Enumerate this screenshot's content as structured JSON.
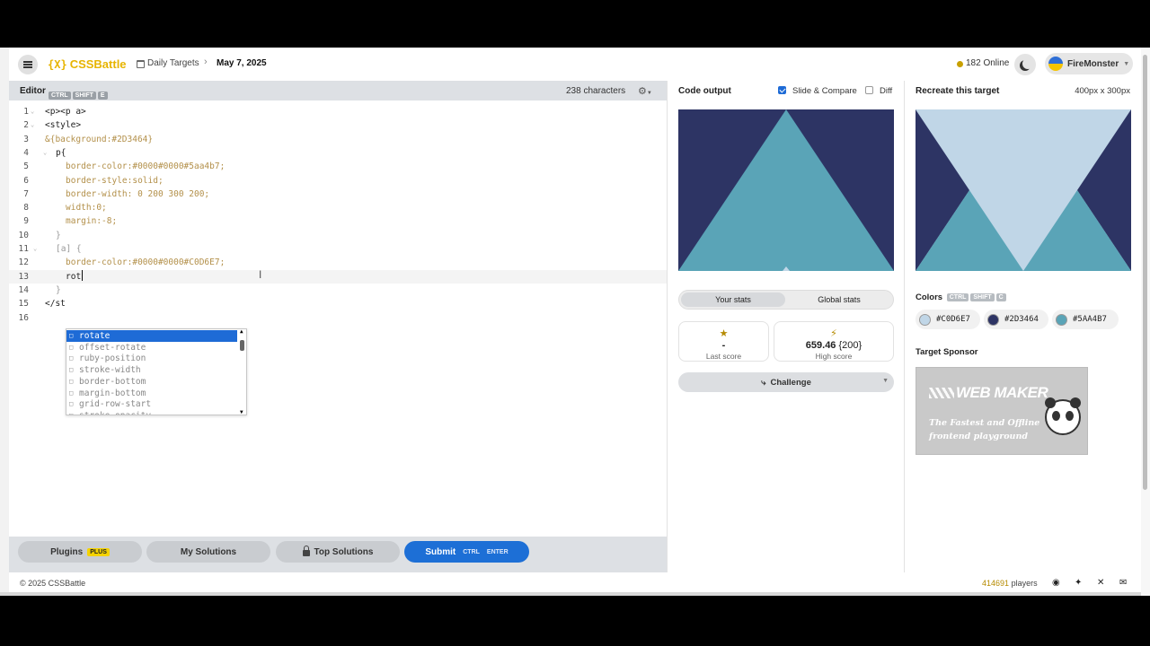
{
  "header": {
    "logo_mark": "{X}",
    "logo_text": "CSSBattle",
    "breadcrumb_section": "Daily Targets",
    "breadcrumb_sep": "›",
    "breadcrumb_current": "May 7, 2025",
    "online_text": "182 Online",
    "username": "FireMonster"
  },
  "editor": {
    "label": "Editor",
    "shortcut": [
      "CTRL",
      "SHIFT",
      "E"
    ],
    "char_count": "238 characters",
    "gear_icon": "⚙",
    "lines": [
      {
        "n": "1",
        "text": "<p><p a>",
        "cls": "c-tag",
        "indent": 40
      },
      {
        "n": "2",
        "text": "<style>",
        "cls": "c-tag",
        "indent": 40
      },
      {
        "n": "3",
        "text": "&{background:#2D3464}",
        "cls": "c-prop",
        "indent": 40
      },
      {
        "n": "4",
        "text": "p{",
        "cls": "c-tag",
        "indent": 52
      },
      {
        "n": "5",
        "text": "border-color:#0000#0000#5aa4b7;",
        "cls": "c-prop",
        "indent": 63
      },
      {
        "n": "6",
        "text": "border-style:solid;",
        "cls": "c-prop",
        "indent": 63
      },
      {
        "n": "7",
        "text": "border-width: 0 200 300 200;",
        "cls": "c-prop",
        "indent": 63
      },
      {
        "n": "8",
        "text": "width:0;",
        "cls": "c-prop",
        "indent": 63
      },
      {
        "n": "9",
        "text": "margin:-8;",
        "cls": "c-prop",
        "indent": 63
      },
      {
        "n": "10",
        "text": "}",
        "cls": "c-dim",
        "indent": 52
      },
      {
        "n": "11",
        "text": "[a] {",
        "cls": "c-dim",
        "indent": 52
      },
      {
        "n": "12",
        "text": "border-color:#0000#0000#C0D6E7;",
        "cls": "c-prop",
        "indent": 63
      },
      {
        "n": "13",
        "text": "rot",
        "cls": "c-tag",
        "indent": 63
      },
      {
        "n": "14",
        "text": "}",
        "cls": "c-dim",
        "indent": 52
      },
      {
        "n": "15",
        "text": "</st",
        "cls": "c-tag",
        "indent": 40
      },
      {
        "n": "16",
        "text": "",
        "cls": "c-tag",
        "indent": 40
      }
    ],
    "autocomplete": [
      "rotate",
      "offset-rotate",
      "ruby-position",
      "stroke-width",
      "border-bottom",
      "margin-bottom",
      "grid-row-start",
      "stroke-opacity"
    ]
  },
  "bottom_buttons": {
    "plugins": "Plugins",
    "plus_badge": "PLUS",
    "my_solutions": "My Solutions",
    "top_solutions": "Top Solutions",
    "submit": "Submit",
    "submit_kbd1": "CTRL",
    "submit_kbd2": "ENTER"
  },
  "output": {
    "title": "Code output",
    "slide_compare": "Slide & Compare",
    "slide_compare_checked": true,
    "diff": "Diff",
    "diff_checked": false,
    "tab_your": "Your stats",
    "tab_global": "Global stats",
    "last_score_value": "-",
    "last_score_label": "Last score",
    "last_score_icon": "★",
    "high_score_value": "659.46",
    "high_score_chars": "{200}",
    "high_score_label": "High score",
    "high_score_icon": "⚡",
    "challenge": "Challenge",
    "challenge_icon": "⤷"
  },
  "target": {
    "title": "Recreate this target",
    "size": "400px x 300px",
    "colors_title": "Colors",
    "colors_kbd": [
      "CTRL",
      "SHIFT",
      "C"
    ],
    "colors": [
      {
        "hex": "#C0D6E7",
        "color": "#C0D6E7"
      },
      {
        "hex": "#2D3464",
        "color": "#2D3464"
      },
      {
        "hex": "#5AA4B7",
        "color": "#5AA4B7"
      }
    ],
    "sponsor_title": "Target Sponsor",
    "sponsor_name": "WEB MAKER",
    "sponsor_tag1": "The Fastest and Offline",
    "sponsor_tag2": "frontend playground"
  },
  "footer": {
    "copyright": "© 2025 CSSBattle",
    "players_count": "414691",
    "players_label": "players",
    "social_icons": [
      "discord-icon",
      "bluesky-icon",
      "x-icon",
      "mail-icon"
    ]
  }
}
